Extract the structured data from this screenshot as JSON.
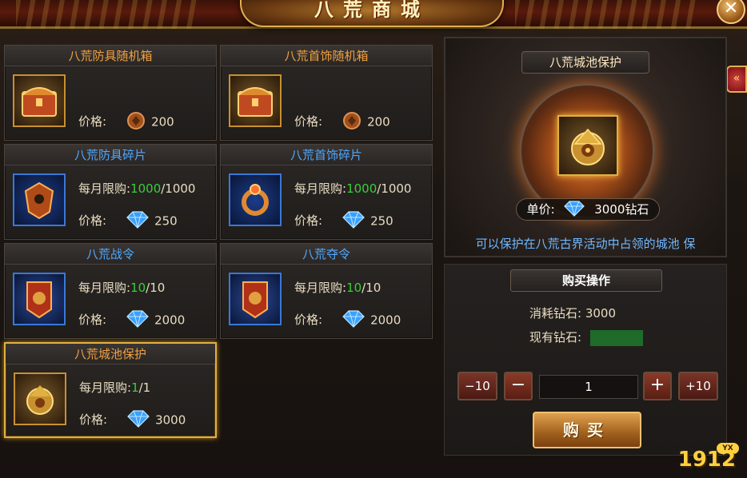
{
  "header": {
    "title": "八荒商城",
    "close_label": "✕",
    "side_tab_icon": "«"
  },
  "colors": {
    "accent_gold": "#e0b040",
    "limit_green": "#38d038",
    "title_blue": "#50a8ff",
    "title_orange": "#f0a040"
  },
  "products": [
    {
      "title": "八荒防具随机箱",
      "title_color": "orange",
      "icon": "armor-box-icon",
      "price_label": "价格:",
      "price_currency": "copper-coin-icon",
      "price": "200"
    },
    {
      "title": "八荒首饰随机箱",
      "title_color": "orange",
      "icon": "jewelry-box-icon",
      "price_label": "价格:",
      "price_currency": "copper-coin-icon",
      "price": "200"
    },
    {
      "title": "八荒防具碎片",
      "title_color": "blue",
      "icon": "armor-shard-icon",
      "limit_label": "每月限购:",
      "limit_cur": "1000",
      "limit_max": "/1000",
      "price_label": "价格:",
      "price_currency": "diamond-icon",
      "price": "250"
    },
    {
      "title": "八荒首饰碎片",
      "title_color": "blue",
      "icon": "jewelry-shard-icon",
      "limit_label": "每月限购:",
      "limit_cur": "1000",
      "limit_max": "/1000",
      "price_label": "价格:",
      "price_currency": "diamond-icon",
      "price": "250"
    },
    {
      "title": "八荒战令",
      "title_color": "blue",
      "icon": "war-token-icon",
      "limit_label": "每月限购:",
      "limit_cur": "10",
      "limit_max": "/10",
      "price_label": "价格:",
      "price_currency": "diamond-icon",
      "price": "2000"
    },
    {
      "title": "八荒夺令",
      "title_color": "blue",
      "icon": "seize-token-icon",
      "limit_label": "每月限购:",
      "limit_cur": "10",
      "limit_max": "/10",
      "price_label": "价格:",
      "price_currency": "diamond-icon",
      "price": "2000"
    },
    {
      "title": "八荒城池保护",
      "title_color": "orange",
      "icon": "city-protect-icon",
      "limit_label": "每月限购:",
      "limit_cur": "1",
      "limit_max": "/1",
      "price_label": "价格:",
      "price_currency": "diamond-icon",
      "price": "3000",
      "selected": true
    }
  ],
  "detail": {
    "title": "八荒城池保护",
    "unit_price_label": "单价:",
    "unit_price": "3000钻石",
    "description": "可以保护在八荒古界活动中占领的城池  保"
  },
  "purchase": {
    "section_title": "购买操作",
    "cost_label": "消耗钻石:",
    "cost_value": "3000",
    "have_label": "现有钻石:",
    "minus10_label": "−10",
    "minus_label": "−",
    "quantity": "1",
    "plus_label": "+",
    "plus10_label": "+10",
    "buy_label": "购买"
  },
  "watermark": {
    "text": "1912",
    "badge": "YX"
  }
}
